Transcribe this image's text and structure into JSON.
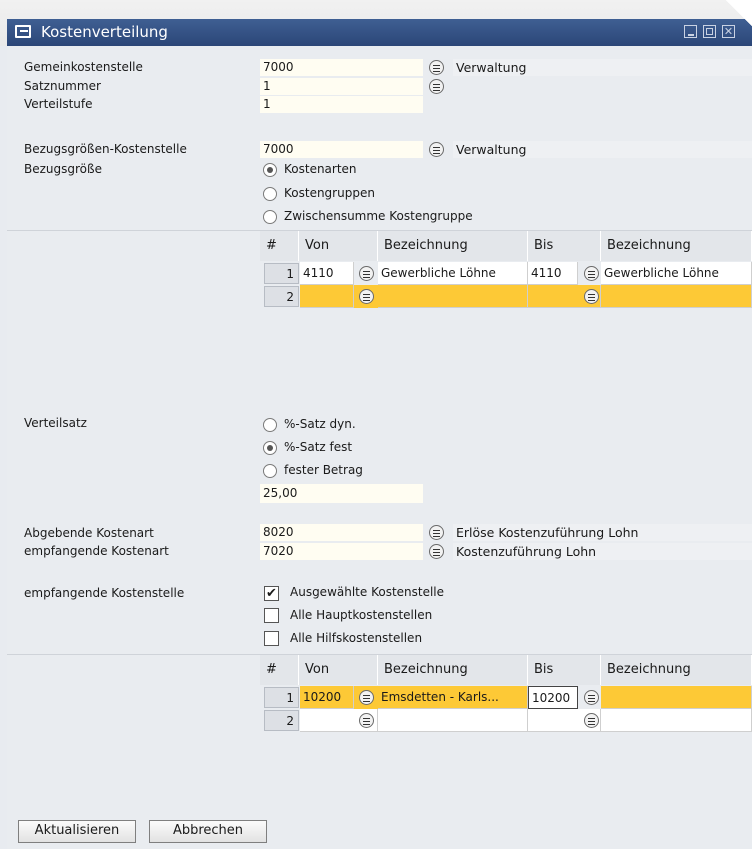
{
  "window": {
    "title": "Kostenverteilung"
  },
  "header": {
    "gemeinkostenstelle": {
      "label": "Gemeinkostenstelle",
      "value": "7000",
      "description": "Verwaltung"
    },
    "satznummer": {
      "label": "Satznummer",
      "value": "1"
    },
    "verteilstufe": {
      "label": "Verteilstufe",
      "value": "1"
    }
  },
  "bezug": {
    "kostenstelle": {
      "label": "Bezugsgrößen-Kostenstelle",
      "value": "7000",
      "description": "Verwaltung"
    },
    "groesse_label": "Bezugsgröße",
    "options": [
      "Kostenarten",
      "Kostengruppen",
      "Zwischensumme Kostengruppe"
    ],
    "selected": "Kostenarten"
  },
  "grid_columns": [
    "#",
    "Von",
    "Bezeichnung",
    "Bis",
    "Bezeichnung"
  ],
  "grid1": {
    "rows": [
      {
        "num": "1",
        "von": "4110",
        "von_desc": "Gewerbliche Löhne",
        "bis": "4110",
        "bis_desc": "Gewerbliche Löhne"
      },
      {
        "num": "2",
        "von": "",
        "von_desc": "",
        "bis": "",
        "bis_desc": ""
      }
    ]
  },
  "verteilsatz": {
    "label": "Verteilsatz",
    "options": [
      "%-Satz dyn.",
      "%-Satz fest",
      "fester Betrag"
    ],
    "selected": "%-Satz fest",
    "value": "25,00"
  },
  "kostenarten": {
    "abgebend": {
      "label": "Abgebende Kostenart",
      "value": "8020",
      "description": "Erlöse Kostenzuführung Lohn"
    },
    "empfangend": {
      "label": "empfangende Kostenart",
      "value": "7020",
      "description": "Kostenzuführung Lohn"
    }
  },
  "empf_kostenstelle": {
    "label": "empfangende Kostenstelle",
    "options": [
      {
        "label": "Ausgewählte Kostenstelle",
        "checked": true
      },
      {
        "label": "Alle Hauptkostenstellen",
        "checked": false
      },
      {
        "label": "Alle Hilfskostenstellen",
        "checked": false
      }
    ]
  },
  "grid2": {
    "rows": [
      {
        "num": "1",
        "von": "10200",
        "von_desc": "Emsdetten - Karls...",
        "bis": "10200",
        "bis_desc": ""
      },
      {
        "num": "2",
        "von": "",
        "von_desc": "",
        "bis": "",
        "bis_desc": ""
      }
    ]
  },
  "buttons": {
    "update": "Aktualisieren",
    "cancel": "Abbrechen"
  },
  "colors": {
    "titlebar": "#2b4677",
    "selected_row": "#fdc936",
    "background": "#e9ecf0"
  },
  "icons": {
    "link": "link-arrow-icon",
    "window": "form-icon"
  }
}
